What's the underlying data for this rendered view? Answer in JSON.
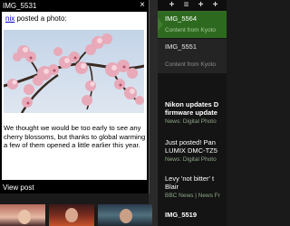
{
  "popup": {
    "title": "IMG_5531",
    "close_glyph": "×",
    "poster_name": "nix",
    "poster_action": " posted a photo:",
    "caption": "We thought we would be too early to see any cherry blossoms, but thanks to global warming a few of them opened a little earlier this year.",
    "view_post_label": "View post"
  },
  "feed": {
    "toolbar": [
      "+",
      "≡",
      "+",
      "+"
    ],
    "items": [
      {
        "title": "IMG_5564",
        "source": "Content from Kyoto"
      },
      {
        "title": "IMG_5551",
        "source": "Content from Kyoto"
      },
      {
        "title": "Nikon updates D",
        "title2": "firmware update",
        "source": "News: Digital Photo"
      },
      {
        "title": "Just posted! Pan",
        "title2": "LUMIX DMC-TZ5",
        "source": "News: Digital Photo"
      },
      {
        "title": "Levy 'not bitter' t",
        "title2": "Blair",
        "source": "BBC News | News Fr"
      },
      {
        "title": "IMG_5519",
        "source": ""
      }
    ]
  },
  "colors": {
    "selected_item": "#2d6a1f",
    "link": "#0000cc",
    "popup_bg": "#000000"
  }
}
